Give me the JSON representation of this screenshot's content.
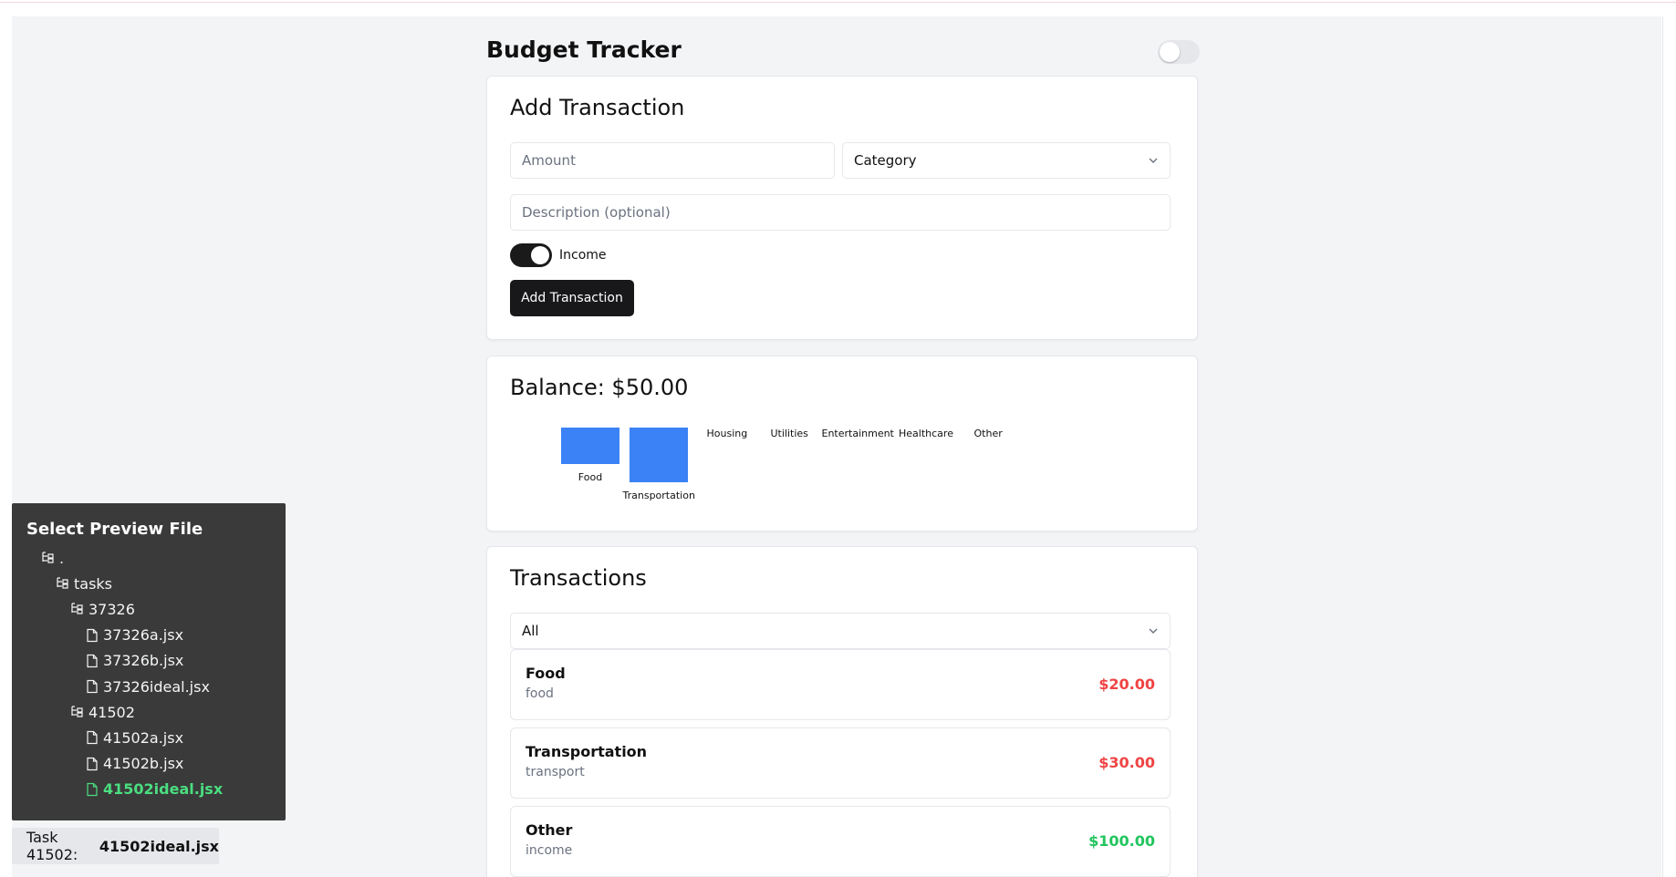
{
  "app": {
    "title": "Budget Tracker"
  },
  "add_transaction": {
    "title": "Add Transaction",
    "amount_placeholder": "Amount",
    "category_value": "Category",
    "description_placeholder": "Description (optional)",
    "income_label": "Income",
    "income_on": true,
    "submit_label": "Add Transaction"
  },
  "balance": {
    "title": "Balance: $50.00"
  },
  "chart_data": {
    "type": "bar",
    "categories": [
      "Food",
      "Transportation",
      "Housing",
      "Utilities",
      "Entertainment",
      "Healthcare",
      "Other"
    ],
    "values": [
      20,
      30,
      0,
      0,
      0,
      0,
      0
    ],
    "bar_color": "#3b82f6"
  },
  "transactions": {
    "title": "Transactions",
    "filter_value": "All",
    "items": [
      {
        "name": "Food",
        "category": "food",
        "amount": "$20.00",
        "color": "#ef4444"
      },
      {
        "name": "Transportation",
        "category": "transport",
        "amount": "$30.00",
        "color": "#ef4444"
      },
      {
        "name": "Other",
        "category": "income",
        "amount": "$100.00",
        "color": "#22c55e"
      }
    ]
  },
  "file_panel": {
    "title": "Select Preview File",
    "tree": [
      {
        "label": ".",
        "type": "folder",
        "depth": 0
      },
      {
        "label": "tasks",
        "type": "folder",
        "depth": 1
      },
      {
        "label": "37326",
        "type": "folder",
        "depth": 2
      },
      {
        "label": "37326a.jsx",
        "type": "file",
        "depth": 3
      },
      {
        "label": "37326b.jsx",
        "type": "file",
        "depth": 3
      },
      {
        "label": "37326ideal.jsx",
        "type": "file",
        "depth": 3
      },
      {
        "label": "41502",
        "type": "folder",
        "depth": 2
      },
      {
        "label": "41502a.jsx",
        "type": "file",
        "depth": 3
      },
      {
        "label": "41502b.jsx",
        "type": "file",
        "depth": 3
      },
      {
        "label": "41502ideal.jsx",
        "type": "file",
        "depth": 3,
        "active": true
      }
    ],
    "active_color": "#4ade80"
  },
  "task_label": {
    "prefix": "Task 41502:",
    "file": "41502ideal.jsx"
  }
}
